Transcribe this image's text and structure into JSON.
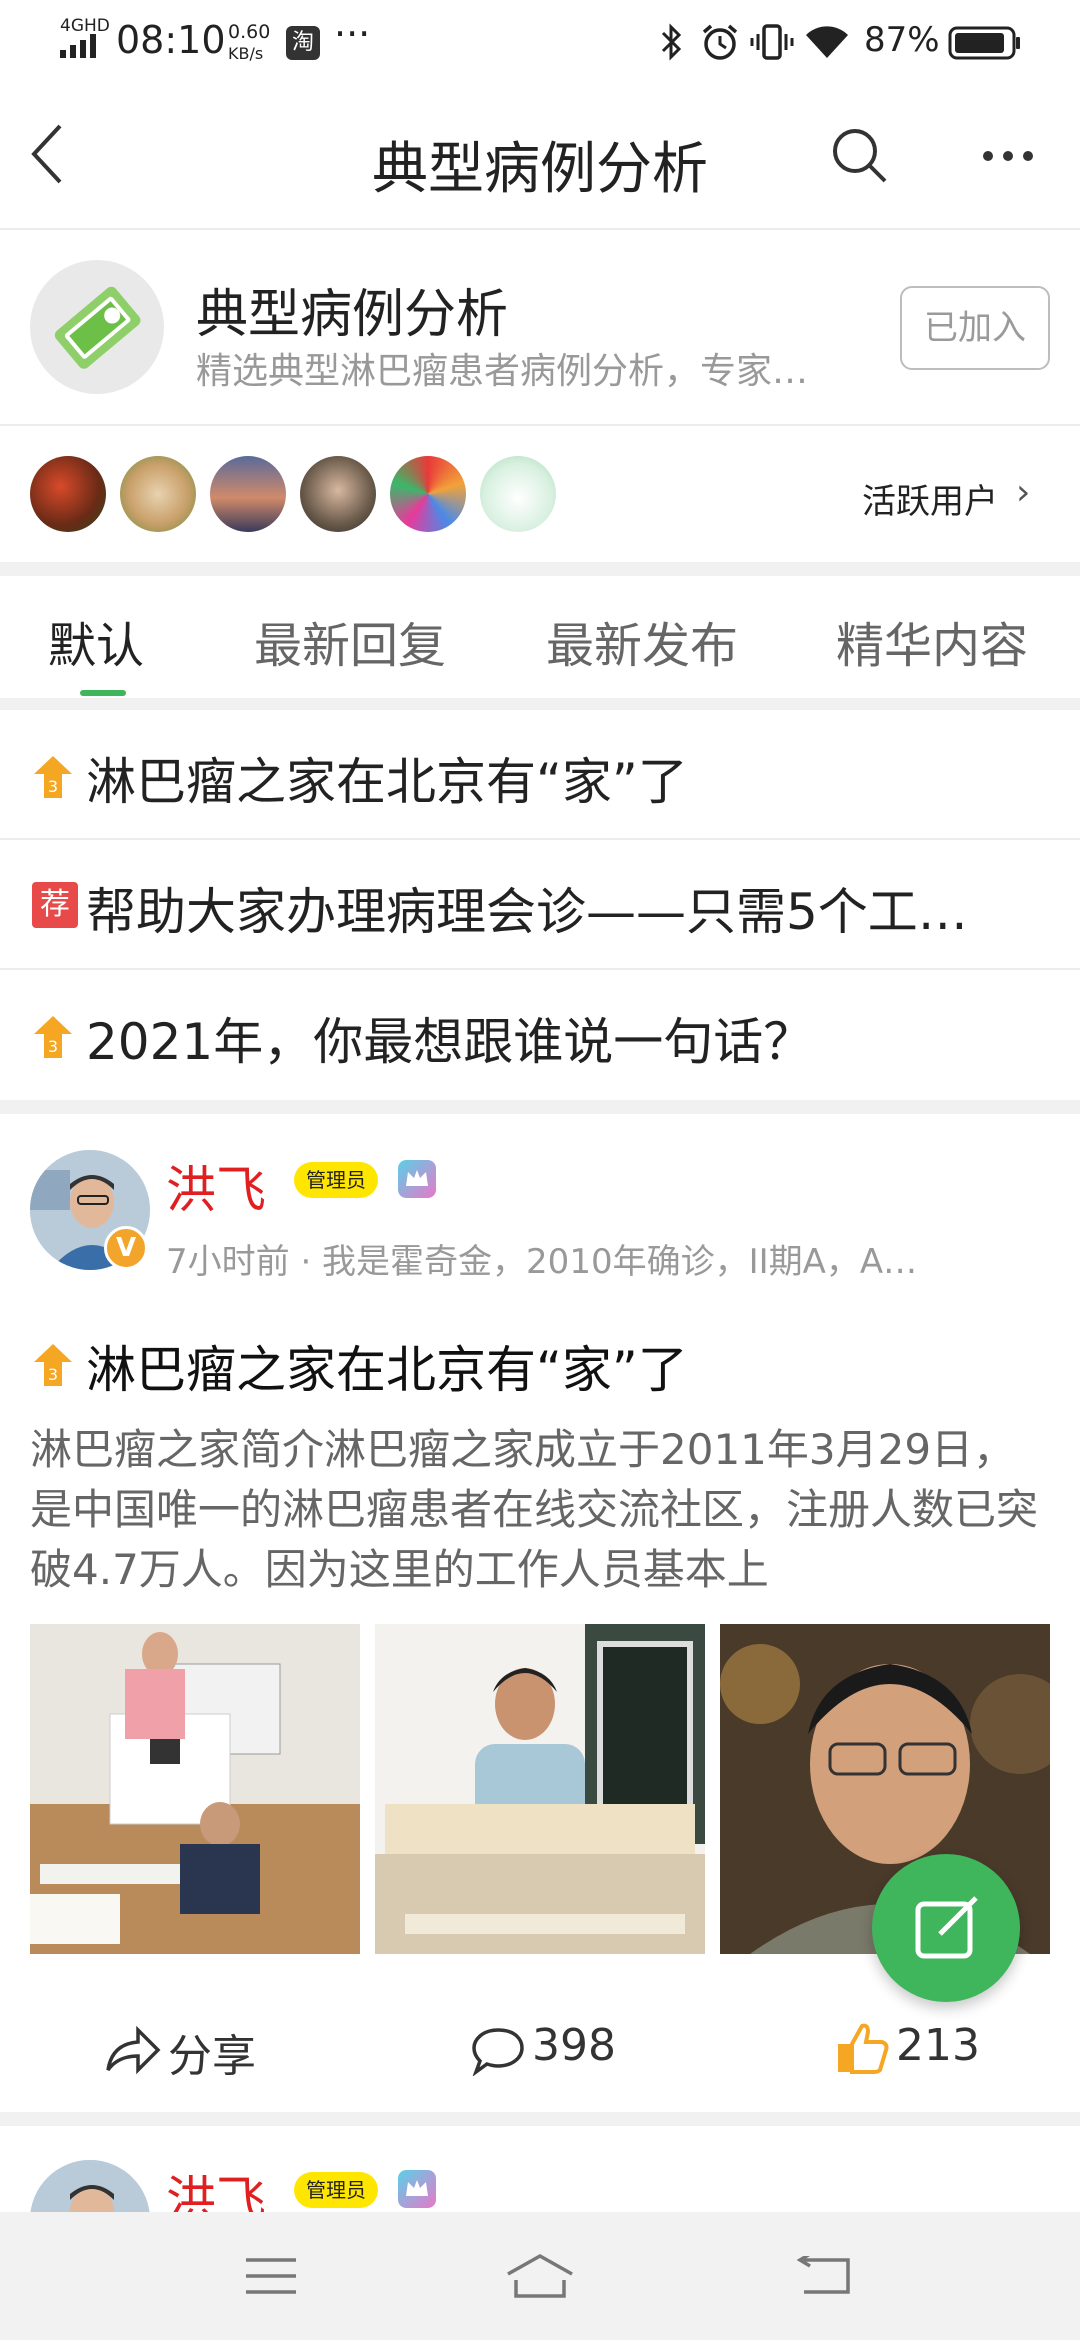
{
  "status_bar": {
    "network": "4GHD",
    "time": "08:10",
    "speed_value": "0.60",
    "speed_unit": "KB/s",
    "taobao_icon": "淘",
    "more": "···",
    "battery": "87%"
  },
  "header": {
    "title": "典型病例分析"
  },
  "group": {
    "title": "典型病例分析",
    "description": "精选典型淋巴瘤患者病例分析，专家…",
    "joined_label": "已加入"
  },
  "active_users": {
    "label": "活跃用户",
    "chevron": "›"
  },
  "tabs": [
    {
      "label": "默认"
    },
    {
      "label": "最新回复"
    },
    {
      "label": "最新发布"
    },
    {
      "label": "精华内容"
    }
  ],
  "pinned": [
    {
      "text": "淋巴瘤之家在北京有“家”了",
      "badge": "3"
    },
    {
      "text": "帮助大家办理病理会诊——只需5个工…",
      "badge": "荐"
    },
    {
      "text": "2021年，你最想跟谁说一句话？",
      "badge": "3"
    }
  ],
  "post": {
    "author": "洪飞",
    "admin_badge": "管理员",
    "verified_badge": "V",
    "meta": "7小时前 · 我是霍奇金，2010年确诊，II期A，A…",
    "title": "淋巴瘤之家在北京有“家”了",
    "title_badge": "3",
    "body": "淋巴瘤之家简介淋巴瘤之家成立于2011年3月29日，是中国唯一的淋巴瘤患者在线交流社区，注册人数已突破4.7万人。因为这里的工作人员基本上",
    "share_label": "分享",
    "comments": "398",
    "likes": "213"
  },
  "next_post": {
    "author": "洪飞",
    "admin_badge": "管理员"
  },
  "colors": {
    "accent_green": "#3fb55c",
    "author_red": "#e02020",
    "admin_yellow": "#ffe600",
    "badge_orange": "#f5a623",
    "recommend_red": "#e84a4a"
  }
}
